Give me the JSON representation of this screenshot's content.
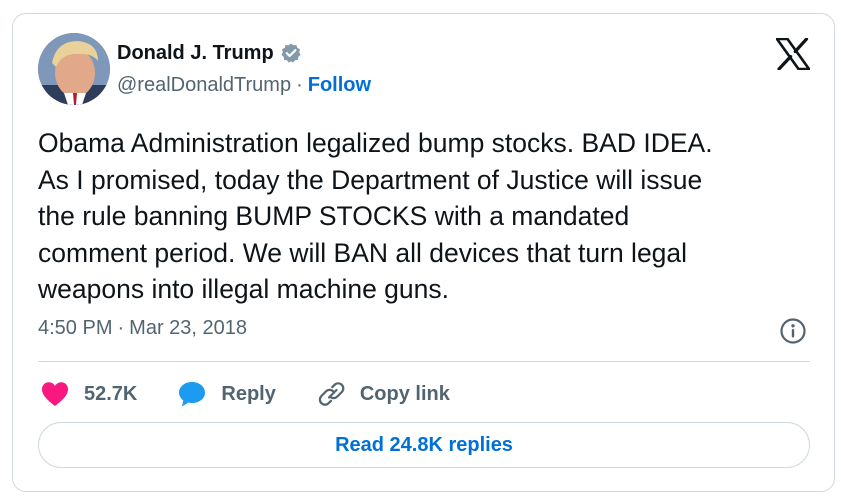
{
  "author": {
    "name": "Donald J. Trump",
    "handle": "@realDonaldTrump",
    "separator": "·",
    "follow_label": "Follow",
    "verified": true
  },
  "tweet": {
    "text": "Obama Administration legalized bump stocks. BAD IDEA.\nAs I promised, today the Department of Justice will issue\nthe rule banning BUMP STOCKS with a mandated\ncomment period. We will BAN all devices that turn legal\nweapons into illegal machine guns.",
    "time": "4:50 PM",
    "date_separator": "·",
    "date": "Mar 23, 2018"
  },
  "actions": {
    "like_count": "52.7K",
    "reply_label": "Reply",
    "copy_link_label": "Copy link"
  },
  "read_replies_label": "Read 24.8K replies",
  "icons": {
    "platform_logo": "x-logo-icon",
    "verified": "verified-badge-icon",
    "info": "info-icon",
    "like": "heart-icon",
    "reply": "speech-bubble-icon",
    "copy_link": "link-icon"
  },
  "colors": {
    "follow_blue": "#006fd6",
    "verified_gray": "#829aab",
    "heart_pink": "#f91880",
    "reply_blue": "#1d9bf0",
    "muted_text": "#536471",
    "border": "#cfd9de"
  }
}
